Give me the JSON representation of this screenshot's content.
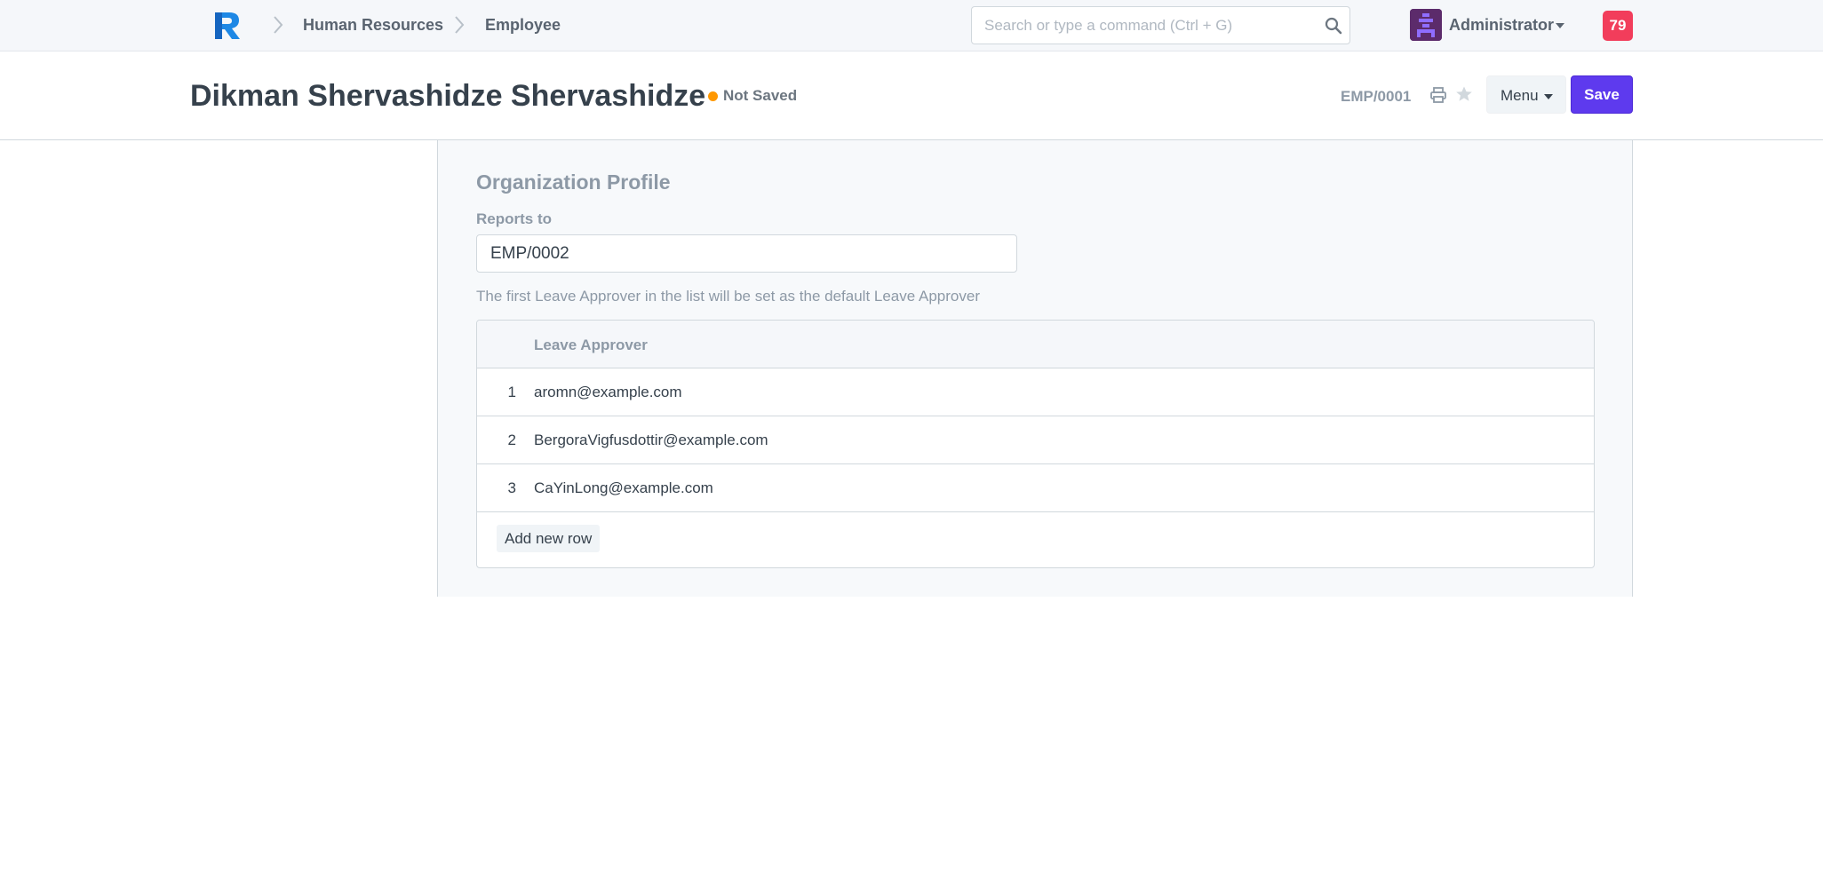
{
  "navbar": {
    "breadcrumbs": [
      "Human Resources",
      "Employee"
    ],
    "search_placeholder": "Search or type a command (Ctrl + G)",
    "user": "Administrator",
    "notification_count": "79",
    "icons": [
      "app-logo-icon",
      "chevron-right-icon",
      "search-icon",
      "avatar-icon",
      "caret-down-icon"
    ]
  },
  "page": {
    "title": "Dikman Shervashidze Shervashidze",
    "status": "Not Saved",
    "status_color": "#ff9800",
    "doc_id": "EMP/0001",
    "menu_label": "Menu",
    "save_label": "Save",
    "accent_color": "#5e3aee",
    "icons": [
      "print-icon",
      "star-icon"
    ]
  },
  "section": {
    "title": "Organization Profile",
    "reports_to_label": "Reports to",
    "reports_to_value": "EMP/0002",
    "help_text": "The first Leave Approver in the list will be set as the default Leave Approver",
    "grid": {
      "column_header": "Leave Approver",
      "rows": [
        {
          "idx": "1",
          "value": "aromn@example.com"
        },
        {
          "idx": "2",
          "value": "BergoraVigfusdottir@example.com"
        },
        {
          "idx": "3",
          "value": "CaYinLong@example.com"
        }
      ],
      "add_row_label": "Add new row"
    }
  }
}
